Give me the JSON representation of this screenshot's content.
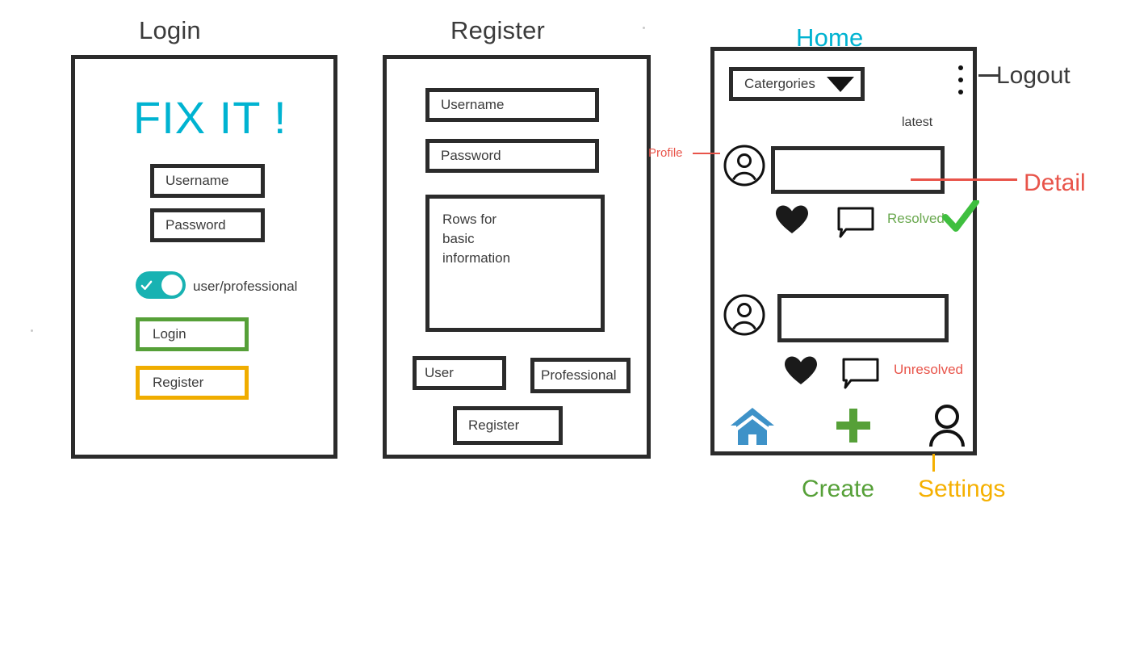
{
  "screens": {
    "login": {
      "title": "Login",
      "brand": "FIX IT !",
      "fields": [
        {
          "label": "Username"
        },
        {
          "label": "Password"
        }
      ],
      "toggle": {
        "label": "user/professional",
        "state": "on",
        "color": "#18b2b2",
        "icon": "check-icon"
      },
      "buttons": [
        {
          "label": "Login",
          "color": "#56a038"
        },
        {
          "label": "Register",
          "color": "#f0ad00"
        }
      ]
    },
    "register": {
      "title": "Register",
      "fields": [
        {
          "label": "Username"
        },
        {
          "label": "Password"
        }
      ],
      "info_box": {
        "lines": [
          "Rows for",
          "basic",
          "information"
        ]
      },
      "role_buttons": [
        {
          "label": "User"
        },
        {
          "label": "Professional"
        }
      ],
      "submit": {
        "label": "Register"
      }
    },
    "home": {
      "title": "Home",
      "title_color": "#00b3d1",
      "dropdown": {
        "label": "Catergories",
        "icon": "chevron-down-icon"
      },
      "overflow_menu": {
        "icon": "kebab-menu-icon"
      },
      "feed_label": "latest",
      "posts": [
        {
          "avatar_icon": "user-avatar-icon",
          "like_icon": "heart-icon",
          "comment_icon": "comment-bubble-icon",
          "status": "Resolved",
          "status_color": "#6aa84f",
          "status_icon": "check-mark-icon"
        },
        {
          "avatar_icon": "user-avatar-icon",
          "like_icon": "heart-icon",
          "comment_icon": "comment-bubble-icon",
          "status": "Unresolved",
          "status_color": "#e8544a",
          "status_icon": null
        }
      ],
      "bottom_nav": [
        {
          "name": "home",
          "icon": "house-icon",
          "color": "#3e92c8"
        },
        {
          "name": "create",
          "icon": "plus-icon",
          "color": "#56a038"
        },
        {
          "name": "settings",
          "icon": "person-icon",
          "color": "#111111"
        }
      ]
    }
  },
  "annotations": [
    {
      "text": "Logout",
      "color": "#3b3b3b",
      "size": "large"
    },
    {
      "text": "Detail",
      "color": "#e8544a",
      "size": "large"
    },
    {
      "text": "Profile",
      "color": "#e8544a",
      "size": "small"
    },
    {
      "text": "Create",
      "color": "#56a038",
      "size": "large"
    },
    {
      "text": "Settings",
      "color": "#f5b000",
      "size": "large"
    }
  ]
}
